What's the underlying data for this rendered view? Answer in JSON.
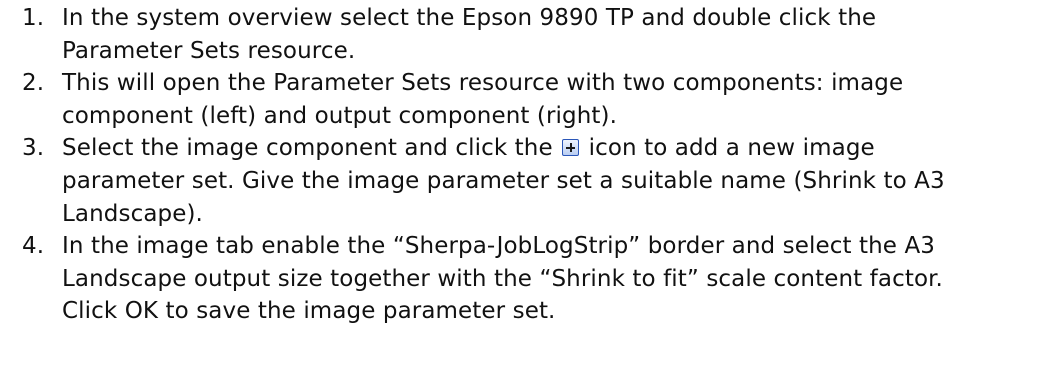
{
  "steps": [
    {
      "number": "1.",
      "lines": [
        "In the system overview select the Epson 9890 TP and double click the",
        "Parameter Sets resource."
      ]
    },
    {
      "number": "2.",
      "lines": [
        "This will open the Parameter Sets resource with two components: image",
        "component (left) and output component (right)."
      ]
    },
    {
      "number": "3.",
      "line1_before_icon": "Select the image component and click the",
      "line1_after_icon": "icon to add a new image",
      "icon": "add-plus-icon",
      "lines": [
        "parameter set. Give the image parameter set a suitable name (Shrink to A3",
        "Landscape)."
      ]
    },
    {
      "number": "4.",
      "lines": [
        "In the image tab enable the “Sherpa-JobLogStrip” border and select the A3",
        "Landscape output size together with the “Shrink to fit” scale content factor.",
        "Click OK to save the image parameter set."
      ]
    }
  ]
}
